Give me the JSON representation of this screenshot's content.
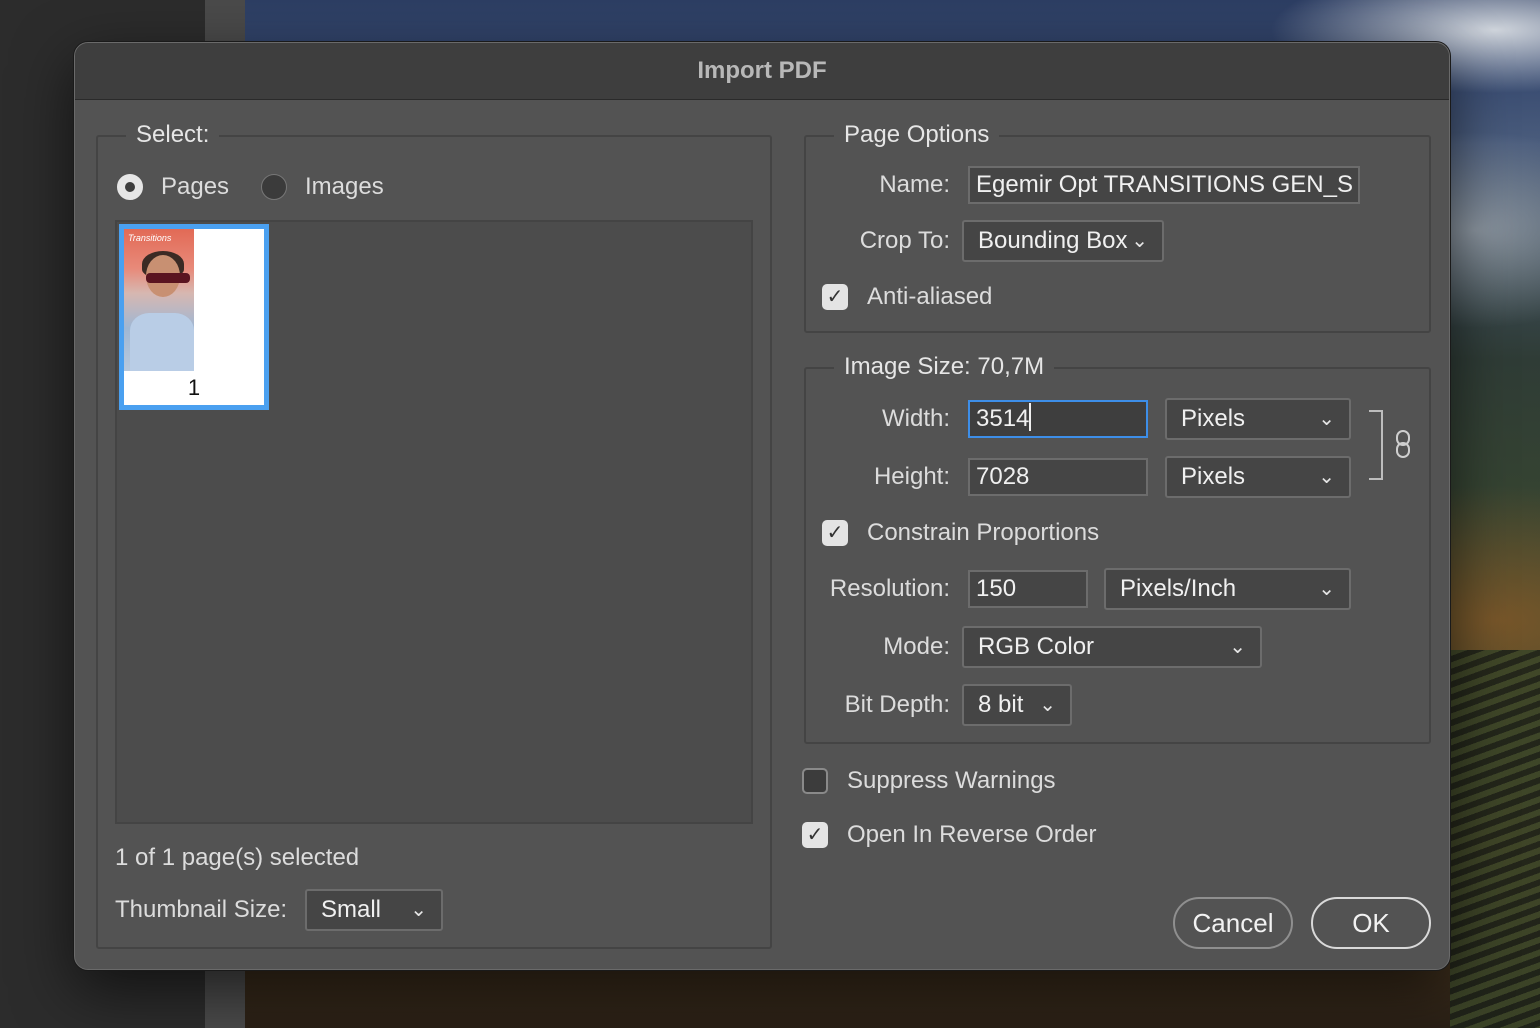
{
  "dialog": {
    "title": "Import PDF"
  },
  "select_panel": {
    "legend": "Select:",
    "options": [
      {
        "label": "Pages",
        "selected": true
      },
      {
        "label": "Images",
        "selected": false
      }
    ],
    "thumbnail": {
      "page_number": "1",
      "brand_text": "Transitions"
    },
    "status": "1 of 1 page(s) selected",
    "thumbnail_size_label": "Thumbnail Size:",
    "thumbnail_size_value": "Small"
  },
  "page_options": {
    "legend": "Page Options",
    "name_label": "Name:",
    "name_value": "Egemir Opt TRANSITIONS GEN_S",
    "crop_to_label": "Crop To:",
    "crop_to_value": "Bounding Box",
    "anti_aliased_label": "Anti-aliased",
    "anti_aliased_checked": true
  },
  "image_size": {
    "legend": "Image Size: 70,7M",
    "width_label": "Width:",
    "width_value": "3514",
    "width_unit": "Pixels",
    "height_label": "Height:",
    "height_value": "7028",
    "height_unit": "Pixels",
    "constrain_label": "Constrain Proportions",
    "constrain_checked": true,
    "resolution_label": "Resolution:",
    "resolution_value": "150",
    "resolution_unit": "Pixels/Inch",
    "mode_label": "Mode:",
    "mode_value": "RGB Color",
    "bit_depth_label": "Bit Depth:",
    "bit_depth_value": "8 bit"
  },
  "options": {
    "suppress_warnings_label": "Suppress Warnings",
    "suppress_warnings_checked": false,
    "reverse_order_label": "Open In Reverse Order",
    "reverse_order_checked": true
  },
  "buttons": {
    "cancel": "Cancel",
    "ok": "OK"
  },
  "icons": {
    "checkmark": "✓",
    "chevron": "⌄",
    "link": "link-icon"
  },
  "colors": {
    "accent": "#4aa0f0",
    "dialog_bg": "#535353",
    "titlebar_bg": "#3e3e3e"
  }
}
